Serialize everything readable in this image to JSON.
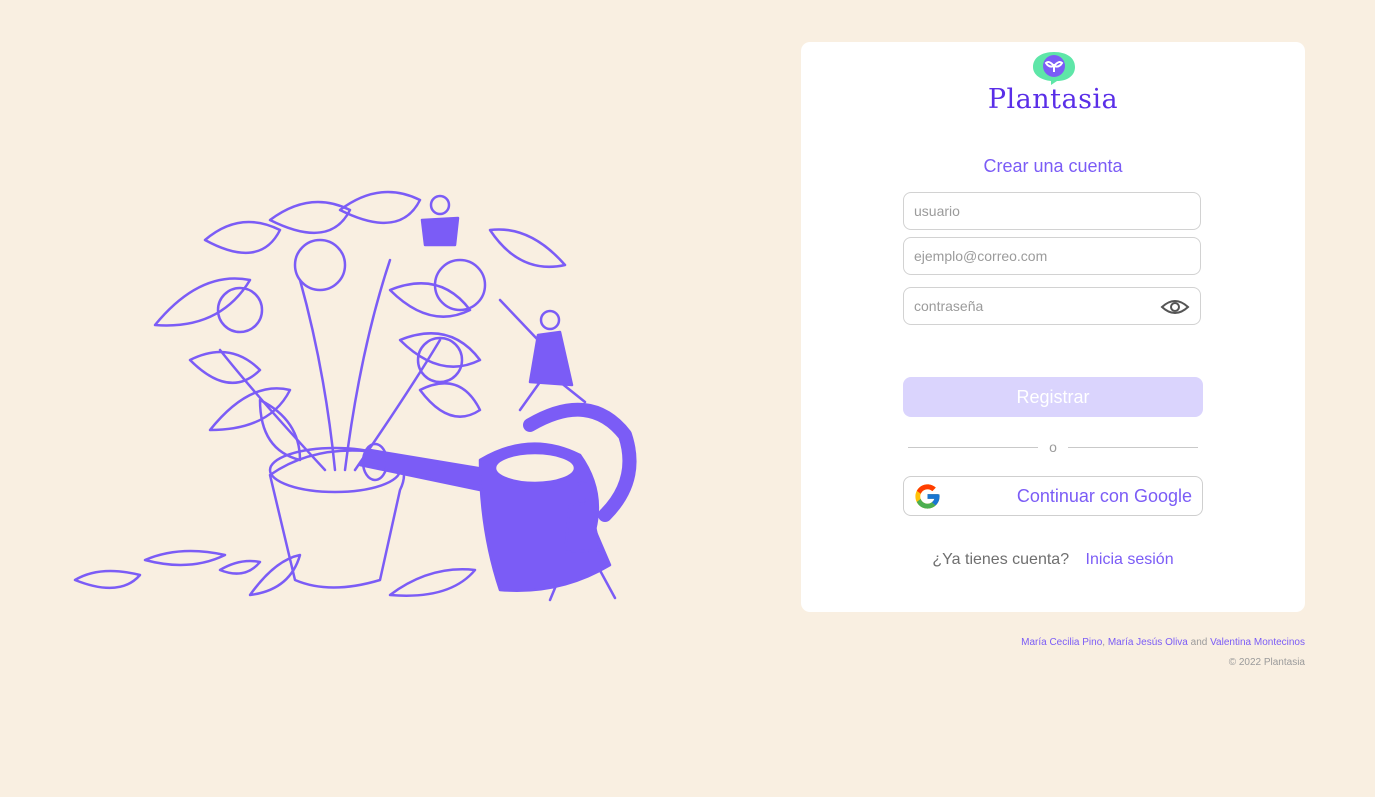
{
  "brand": {
    "name": "Plantasia"
  },
  "form": {
    "title": "Crear una cuenta",
    "username_placeholder": "usuario",
    "email_placeholder": "ejemplo@correo.com",
    "password_placeholder": "contraseña",
    "register_label": "Registrar",
    "divider_label": "o",
    "google_label": "Continuar con Google",
    "have_account_text": "¿Ya tienes cuenta?",
    "login_link": "Inicia sesión"
  },
  "footer": {
    "authors": [
      "María Cecilia Pino",
      "María Jesús Oliva",
      "Valentina Montecinos"
    ],
    "separator_comma": ",",
    "separator_and": "and",
    "copyright": "© 2022 Plantasia"
  },
  "colors": {
    "background": "#f9efe1",
    "accent": "#7b5cf6",
    "brand": "#5a2ee8",
    "register_button_disabled": "#dad4fd",
    "logo_green": "#5ee6a8"
  },
  "icons": [
    "plant-logo-icon",
    "eye-icon",
    "google-icon"
  ]
}
